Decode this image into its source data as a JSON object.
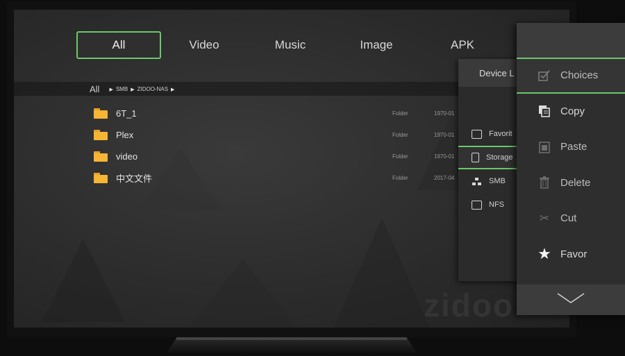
{
  "tabs": [
    {
      "label": "All"
    },
    {
      "label": "Video"
    },
    {
      "label": "Music"
    },
    {
      "label": "Image"
    },
    {
      "label": "APK"
    }
  ],
  "breadcrumb": {
    "root": "All",
    "parts": [
      "SMB",
      "ZIDOO-NAS"
    ]
  },
  "files": [
    {
      "name": "6T_1",
      "type": "Folder",
      "date": "1970-01"
    },
    {
      "name": "Plex",
      "type": "Folder",
      "date": "1970-01"
    },
    {
      "name": "video",
      "type": "Folder",
      "date": "1970-01"
    },
    {
      "name": "中文文件",
      "type": "Folder",
      "date": "2017-04"
    }
  ],
  "device_panel": {
    "title": "Device L",
    "items": [
      {
        "label": "Favorit",
        "icon": "favorite-folder-icon"
      },
      {
        "label": "Storage",
        "icon": "storage-icon",
        "active": true
      },
      {
        "label": "SMB",
        "icon": "network-icon"
      },
      {
        "label": "NFS",
        "icon": "nfs-folder-icon"
      }
    ]
  },
  "context_menu": {
    "items": [
      {
        "label": "Choices",
        "icon": "checkbox-icon",
        "selected": true
      },
      {
        "label": "Copy",
        "icon": "copy-icon"
      },
      {
        "label": "Paste",
        "icon": "paste-icon"
      },
      {
        "label": "Delete",
        "icon": "trash-icon"
      },
      {
        "label": "Cut",
        "icon": "scissors-icon"
      },
      {
        "label": "Favor",
        "icon": "star-icon"
      }
    ]
  },
  "watermark": "zidoo",
  "colors": {
    "accent": "#6ac96a",
    "folder": "#f5b635"
  }
}
